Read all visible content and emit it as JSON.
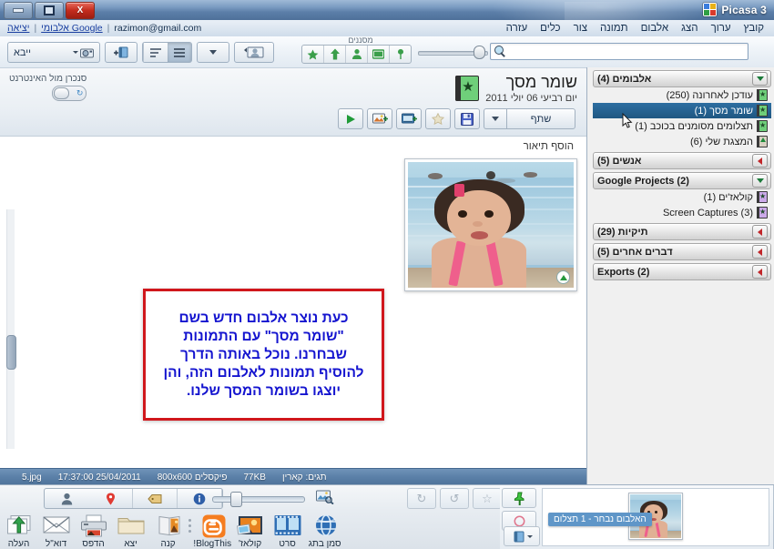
{
  "window": {
    "app_title": "Picasa 3",
    "controls": {
      "close": "X",
      "maximize": "❑",
      "minimize": "—"
    }
  },
  "menubar": {
    "items": [
      {
        "label": "קובץ",
        "name": "menu-file"
      },
      {
        "label": "ערוך",
        "name": "menu-edit"
      },
      {
        "label": "הצג",
        "name": "menu-view"
      },
      {
        "label": "אלבום",
        "name": "menu-album"
      },
      {
        "label": "תמונה",
        "name": "menu-picture"
      },
      {
        "label": "צור",
        "name": "menu-create"
      },
      {
        "label": "כלים",
        "name": "menu-tools"
      },
      {
        "label": "עזרה",
        "name": "menu-help"
      }
    ],
    "account": {
      "signout": "יציאה",
      "albums_link": "אלבומי Google",
      "email": "razimon@gmail.com",
      "separator": "|"
    }
  },
  "toolbar": {
    "search_placeholder": "",
    "search_value": "",
    "filters_label": "מסננים",
    "filter_buttons": [
      {
        "name": "filter-geotag-icon",
        "title": "סמון בתג"
      },
      {
        "name": "filter-video-icon",
        "title": "סרטונים"
      },
      {
        "name": "filter-faces-icon",
        "title": "פרצופים"
      },
      {
        "name": "filter-uploaded-icon",
        "title": "הועלו"
      },
      {
        "name": "filter-starred-icon",
        "title": "מסומן בכוכב"
      }
    ],
    "import_label": "ייבא",
    "zoom_slider_value": 82
  },
  "sidebar": {
    "groups": [
      {
        "name": "albums",
        "label": "אלבומים (4)",
        "expanded": true,
        "items": [
          {
            "label": "עודכן לאחרונה (250)",
            "icon": "green-album-icon",
            "selected": false
          },
          {
            "label": "שומר מסך (1)",
            "icon": "green-album-icon",
            "selected": true
          },
          {
            "label": "תצלומים מסומנים בכוכב (1)",
            "icon": "green-album-icon",
            "selected": false
          },
          {
            "label": "המצגת שלי (6)",
            "icon": "upload-album-icon",
            "selected": false
          }
        ]
      },
      {
        "name": "people",
        "label": "אנשים (5)",
        "expanded": false,
        "items": []
      },
      {
        "name": "google-projects",
        "label": "Google Projects (2)",
        "expanded": true,
        "items": [
          {
            "label": "קולאז'ים (1)",
            "icon": "purple-album-icon",
            "selected": false
          },
          {
            "label": "Screen Captures (3)",
            "icon": "purple-album-icon",
            "selected": false
          }
        ]
      },
      {
        "name": "folders",
        "label": "תיקיות (29)",
        "expanded": false,
        "items": []
      },
      {
        "name": "other-stuff",
        "label": "דברים אחרים (5)",
        "expanded": false,
        "items": []
      },
      {
        "name": "exports",
        "label": "Exports (2)",
        "expanded": false,
        "items": []
      }
    ]
  },
  "album_header": {
    "title": "שומר מסך",
    "date": "יום רביעי 06 יולי 2011",
    "share_label": "שתף",
    "sync_label": "סנכרן מול האינטרנט",
    "action_buttons": [
      {
        "name": "play-slideshow-button",
        "icon": "play-icon"
      },
      {
        "name": "add-photo-button",
        "icon": "add-photo-icon"
      },
      {
        "name": "add-movie-button",
        "icon": "add-movie-icon"
      },
      {
        "name": "star-button",
        "icon": "star-icon"
      },
      {
        "name": "save-button",
        "icon": "floppy-disk-icon"
      }
    ]
  },
  "photo_area": {
    "add_caption": "הוסף תיאור",
    "callout_text": "כעת נוצר אלבום חדש בשם \"שומר מסך\" עם התמונות שבחרנו. נוכל באותה הדרך להוסיף תמונות לאלבום הזה, והן יוצגו בשומר המסך שלנו.",
    "callout_border_color": "#d0171c",
    "callout_text_color": "#1414cf"
  },
  "statusbar": {
    "filename": "5.jpg",
    "datetime": "17:37:00 25/04/2011",
    "dimensions": "800x600 פיקסלים",
    "filesize": "77KB",
    "tags": "תגים: קארין"
  },
  "bottom_bar": {
    "info_buttons": [
      {
        "name": "info-icon",
        "glyph": "i"
      },
      {
        "name": "tag-icon",
        "glyph": "⚑"
      },
      {
        "name": "places-pin-icon",
        "glyph": "●"
      },
      {
        "name": "person-icon",
        "glyph": "●"
      }
    ],
    "actions": [
      {
        "label": "סמן בתג",
        "name": "geotag-action",
        "icon": "globe-icon"
      },
      {
        "label": "סרט",
        "name": "movie-action",
        "icon": "film-icon"
      },
      {
        "label": "קולאז'",
        "name": "collage-action",
        "icon": "collage-icon"
      },
      {
        "label": "BlogThis!",
        "name": "blogthis-action",
        "icon": "blogger-icon"
      },
      {
        "label": "קנה",
        "name": "order-prints-action",
        "icon": "book-icon"
      },
      {
        "label": "יצא",
        "name": "export-action",
        "icon": "folder-icon"
      },
      {
        "label": "הדפס",
        "name": "print-action",
        "icon": "printer-icon"
      },
      {
        "label": "דוא\"ל",
        "name": "email-action",
        "icon": "envelope-icon"
      },
      {
        "label": "העלה",
        "name": "upload-action",
        "icon": "upload-icon"
      }
    ],
    "edit_buttons": [
      {
        "name": "rotate-right-button",
        "glyph": "↻"
      },
      {
        "name": "rotate-left-button",
        "glyph": "↺"
      },
      {
        "name": "star-toggle-button",
        "glyph": "☆"
      }
    ]
  },
  "tray": {
    "tooltip": "האלבום נבחר - 1 תצלום",
    "hold_icon": "hold-pin-icon",
    "clear_icon": "clear-circle-icon",
    "add_to_icon": "add-to-album-icon"
  }
}
